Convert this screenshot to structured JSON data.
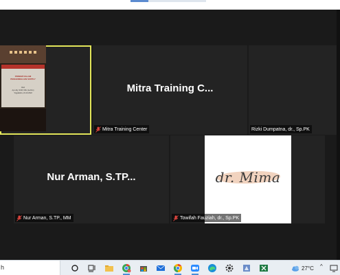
{
  "colors": {
    "background": "#1a1a1a",
    "tile": "#232323",
    "active_speaker_border": "#e3e65a",
    "muted_mic": "#e0463f",
    "taskbar": "#e9eef3"
  },
  "presentation": {
    "title_line1": "PRINSIP DALAM",
    "title_line2": "PENGENDALIAN SUPPLY",
    "subtitle_line1": "Oleh",
    "subtitle_line2": "Ayu Aliy, SKM, MSc (Ia Ahm)",
    "subtitle_line3": "Yogyakarta, 24-10-2022"
  },
  "participants": [
    {
      "name_large": "",
      "label": "",
      "muted": false,
      "has_video": true,
      "active_speaker": true
    },
    {
      "name_large": "Mitra Training C...",
      "label": "Mitra Training Center",
      "muted": true,
      "has_video": false
    },
    {
      "name_large": "",
      "label": "Rizki Dumpatna, dr., Sp.PK",
      "muted": false,
      "has_video": false
    },
    {
      "name_large": "Nur Arman, S.TP...",
      "label": "Nur Arman, S.TP., MM",
      "muted": true,
      "has_video": false
    },
    {
      "name_large": "",
      "label": "Towifah Fauziah, dr., Sp.PK",
      "muted": true,
      "has_video": true,
      "video_text": "dr. Mima"
    }
  ],
  "taskbar": {
    "search_text": "h",
    "icons": [
      "start-search-icon",
      "task-view-icon",
      "file-explorer-icon",
      "chrome-icon",
      "store-icon",
      "mail-icon",
      "chrome-icon",
      "zoom-icon",
      "edge-icon",
      "settings-icon",
      "app-icon",
      "excel-icon"
    ],
    "chrome_badge": "1",
    "weather_temp": "27°C",
    "weather_icon": "cloud-icon",
    "tray_chevron": "^"
  }
}
